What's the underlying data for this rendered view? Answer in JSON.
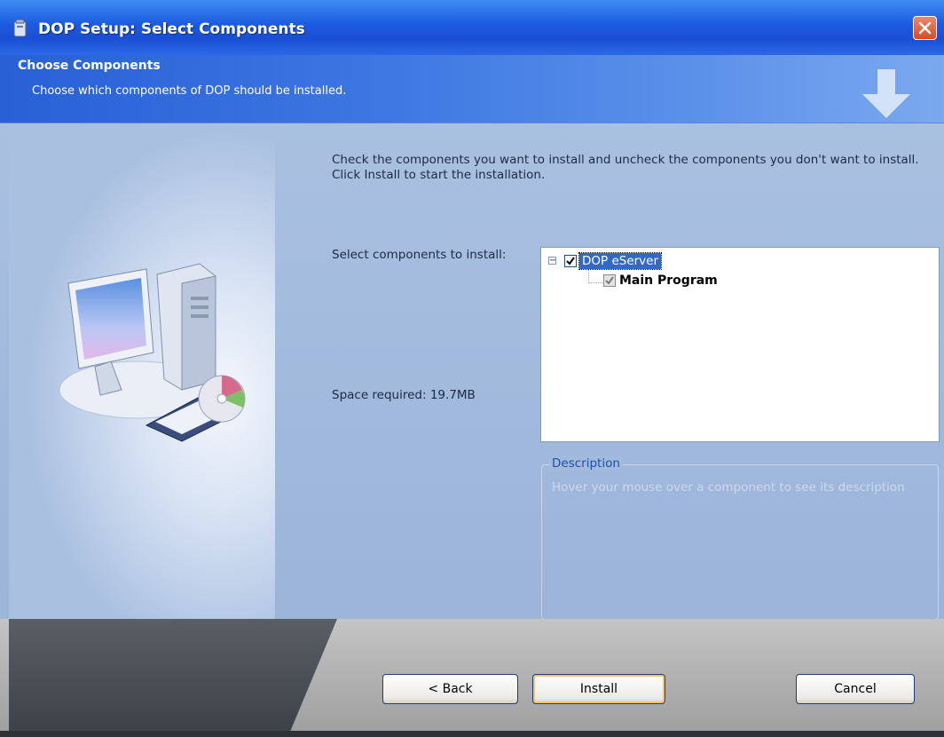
{
  "window": {
    "title": "DOP Setup: Select Components",
    "close_icon": "close-icon"
  },
  "header": {
    "title": "Choose Components",
    "subtitle": "Choose which components of DOP should be installed.",
    "icon": "down-arrow-icon"
  },
  "main": {
    "instructions": "Check the components you want to install and uncheck the components you don't want to install. Click Install to start the installation.",
    "select_label": "Select components to install:",
    "space_required": "Space required: 19.7MB",
    "components": [
      {
        "label": "DOP eServer",
        "checked": true,
        "selected": true,
        "expanded": true
      },
      {
        "label": "Main Program",
        "checked": true,
        "disabled": true
      }
    ],
    "description": {
      "legend": "Description",
      "text": "Hover your mouse over a component to see its description"
    }
  },
  "footer": {
    "back_label": "< Back",
    "install_label": "Install",
    "cancel_label": "Cancel"
  },
  "colors": {
    "titlebar": "#1c5ae0",
    "header": "#3c77e2",
    "body": "#a9c0e1",
    "selection": "#316ac5",
    "close_button": "#d94b22"
  }
}
